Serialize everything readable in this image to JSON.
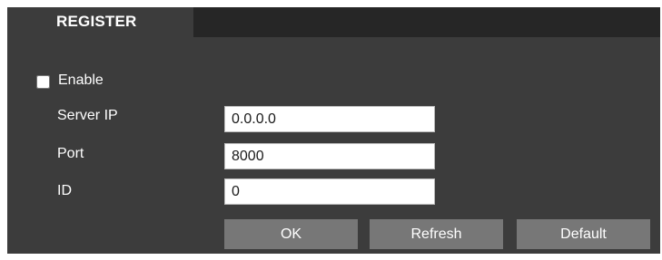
{
  "tabs": [
    {
      "label": "REGISTER",
      "active": true
    }
  ],
  "form": {
    "enable": {
      "label": "Enable",
      "checked": false
    },
    "fields": [
      {
        "label": "Server IP",
        "value": "0.0.0.0"
      },
      {
        "label": "Port",
        "value": "8000"
      },
      {
        "label": "ID",
        "value": "0"
      }
    ]
  },
  "buttons": {
    "ok": "OK",
    "refresh": "Refresh",
    "default": "Default"
  },
  "colors": {
    "panel_background": "#3c3c3c",
    "tab_bar_background": "#262626",
    "button_background": "#777777",
    "text": "#ffffff"
  }
}
